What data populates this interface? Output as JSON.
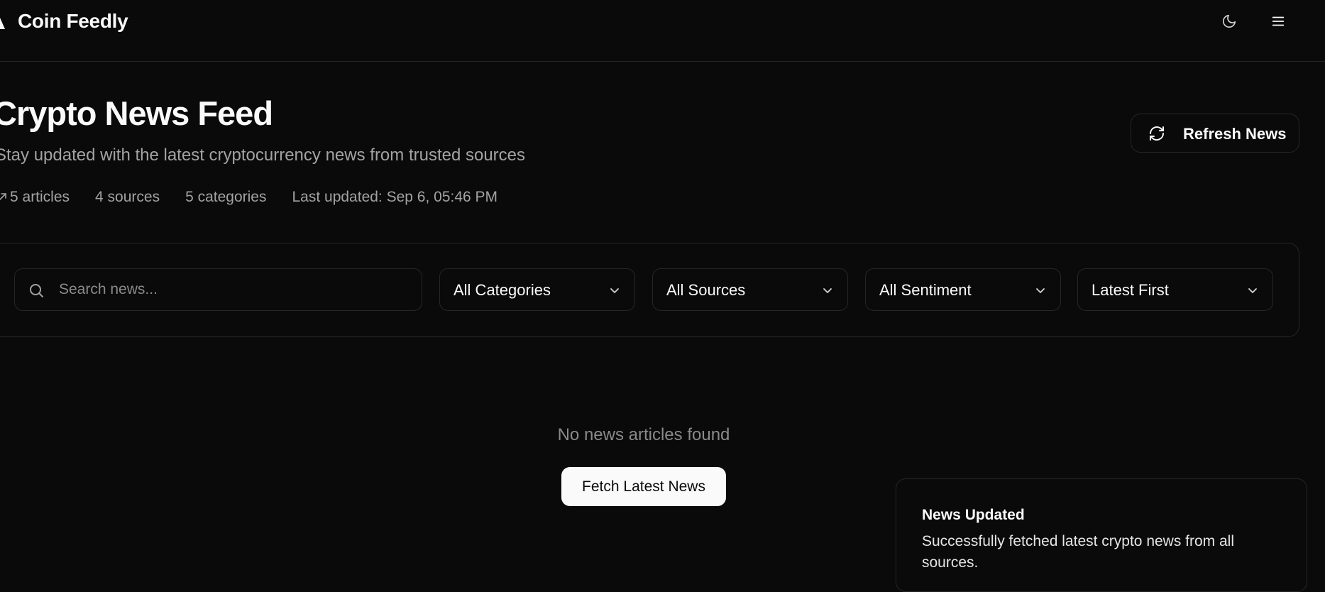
{
  "header": {
    "brand": "Coin Feedly",
    "icons": {
      "theme": "moon-icon",
      "menu": "menu-icon",
      "logo": "logo-triangle-icon"
    }
  },
  "page": {
    "title": "Crypto News Feed",
    "subtitle": "Stay updated with the latest cryptocurrency news from trusted sources",
    "refresh_label": "Refresh News"
  },
  "stats": {
    "articles": "5 articles",
    "sources": "4 sources",
    "categories": "5 categories",
    "last_updated": "Last updated: Sep 6, 05:46 PM"
  },
  "filters": {
    "search_placeholder": "Search news...",
    "search_value": "",
    "category": "All Categories",
    "source": "All Sources",
    "sentiment": "All Sentiment",
    "sort": "Latest First"
  },
  "empty_state": {
    "message": "No news articles found",
    "fetch_label": "Fetch Latest News"
  },
  "toast": {
    "title": "News Updated",
    "description": "Successfully fetched latest crypto news from all sources."
  },
  "colors": {
    "background": "#0a0a0a",
    "border": "#262626",
    "text": "#fafafa",
    "muted": "#a3a3a3",
    "button_bg": "#fafafa"
  }
}
